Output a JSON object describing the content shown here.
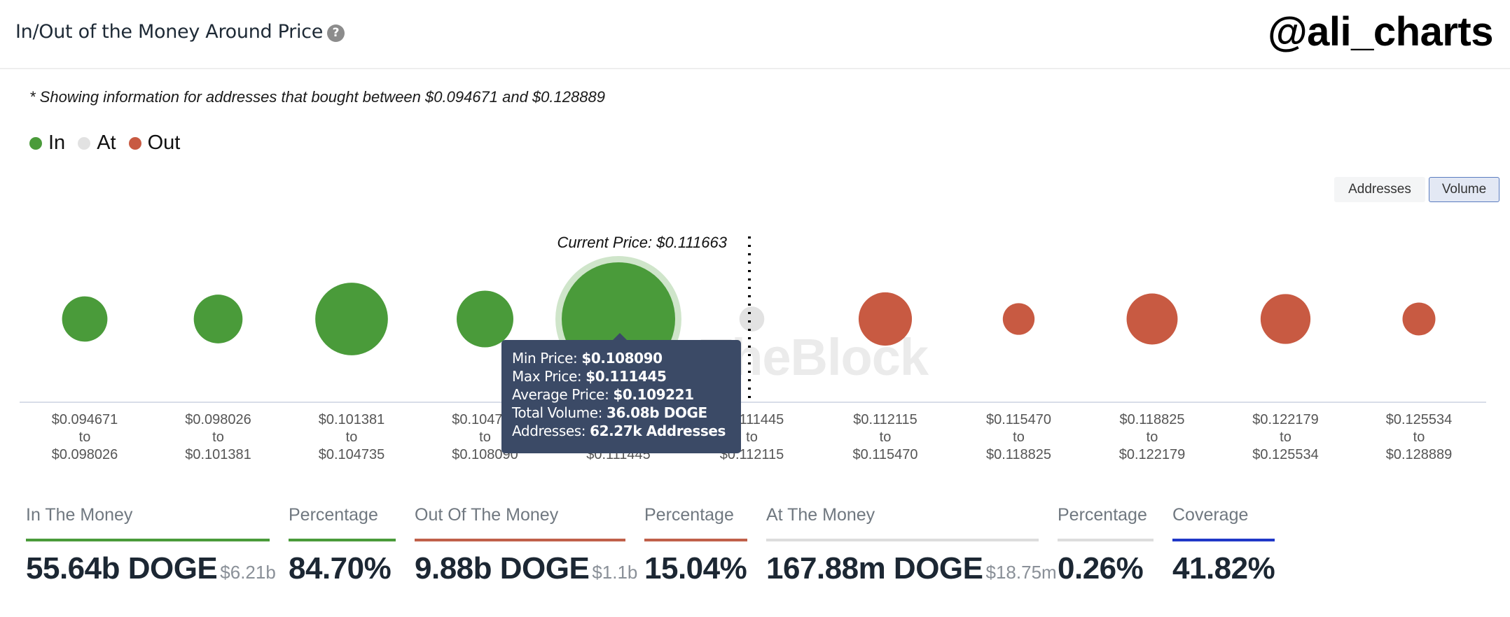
{
  "header": {
    "title": "In/Out of the Money Around Price",
    "help_icon": "question-circle-icon",
    "brand": "@ali_charts"
  },
  "note": "* Showing information for addresses that bought between $0.094671 and $0.128889",
  "legend": [
    {
      "label": "In",
      "color": "#4a9b3a"
    },
    {
      "label": "At",
      "color": "#e2e2e2"
    },
    {
      "label": "Out",
      "color": "#c85a42"
    }
  ],
  "toggle": {
    "addresses_label": "Addresses",
    "volume_label": "Volume",
    "selected": "Volume"
  },
  "watermark": "TheBlock",
  "chart_data": {
    "type": "bubble",
    "title": "In/Out of the Money Around Price",
    "metric": "Volume",
    "current_price_label": "Current Price: $0.111663",
    "current_price": 0.111663,
    "categories": [
      {
        "from": "$0.094671",
        "to": "$0.098026",
        "status": "in",
        "relative_size": 0.4
      },
      {
        "from": "$0.098026",
        "to": "$0.101381",
        "status": "in",
        "relative_size": 0.43
      },
      {
        "from": "$0.101381",
        "to": "$0.104735",
        "status": "in",
        "relative_size": 0.64
      },
      {
        "from": "$0.104735",
        "to": "$0.108090",
        "status": "in",
        "relative_size": 0.5
      },
      {
        "from": "$0.108090",
        "to": "$0.111445",
        "status": "in",
        "relative_size": 1.0,
        "highlighted": true
      },
      {
        "from": "$0.111445",
        "to": "$0.112115",
        "status": "at",
        "relative_size": 0.22
      },
      {
        "from": "$0.112115",
        "to": "$0.115470",
        "status": "out",
        "relative_size": 0.47
      },
      {
        "from": "$0.115470",
        "to": "$0.118825",
        "status": "out",
        "relative_size": 0.28
      },
      {
        "from": "$0.118825",
        "to": "$0.122179",
        "status": "out",
        "relative_size": 0.45
      },
      {
        "from": "$0.122179",
        "to": "$0.125534",
        "status": "out",
        "relative_size": 0.44
      },
      {
        "from": "$0.125534",
        "to": "$0.128889",
        "status": "out",
        "relative_size": 0.29
      }
    ],
    "tick_connector": "to",
    "colors": {
      "in": "#4a9b3a",
      "at": "#e2e2e2",
      "out": "#c85a42",
      "halo": "#cfe5ca",
      "axis": "#d8dde8"
    },
    "tooltip": {
      "rows": [
        {
          "label": "Min Price: ",
          "value": "$0.108090"
        },
        {
          "label": "Max Price: ",
          "value": "$0.111445"
        },
        {
          "label": "Average Price: ",
          "value": "$0.109221"
        },
        {
          "label": "Total Volume: ",
          "value": "36.08b DOGE"
        },
        {
          "label": "Addresses: ",
          "value": "62.27k Addresses"
        }
      ]
    }
  },
  "stats": [
    {
      "label": "In The Money",
      "value": "55.64b DOGE",
      "sub": "$6.21b",
      "color": "#4a9b3a"
    },
    {
      "label": "Percentage",
      "value": "84.70%",
      "sub": "",
      "color": "#4a9b3a"
    },
    {
      "label": "Out Of The Money",
      "value": "9.88b DOGE",
      "sub": "$1.1b",
      "color": "#c0604a"
    },
    {
      "label": "Percentage",
      "value": "15.04%",
      "sub": "",
      "color": "#c0604a"
    },
    {
      "label": "At The Money",
      "value": "167.88m DOGE",
      "sub": "$18.75m",
      "color": "#dddddd"
    },
    {
      "label": "Percentage",
      "value": "0.26%",
      "sub": "",
      "color": "#dddddd"
    },
    {
      "label": "Coverage",
      "value": "41.82%",
      "sub": "",
      "color": "#2038c8"
    }
  ]
}
